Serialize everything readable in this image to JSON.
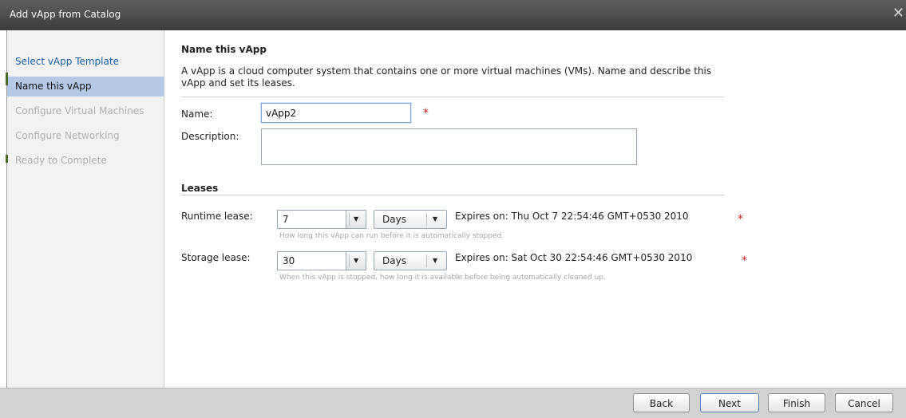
{
  "dialog": {
    "title": "Add vApp from Catalog"
  },
  "sidebar": {
    "items": [
      {
        "label": "Select vApp Template",
        "state": "link"
      },
      {
        "label": "Name this vApp",
        "state": "active"
      },
      {
        "label": "Configure Virtual Machines",
        "state": "disabled"
      },
      {
        "label": "Configure Networking",
        "state": "disabled"
      },
      {
        "label": "Ready to Complete",
        "state": "disabled"
      }
    ]
  },
  "main": {
    "title": "Name this vApp",
    "description": "A vApp is a cloud computer system that contains one or more virtual machines (VMs). Name and describe this vApp and set its leases.",
    "name_label": "Name:",
    "name_value": "vApp2",
    "description_label": "Description:",
    "description_value": "",
    "required_mark": "*"
  },
  "leases": {
    "title": "Leases",
    "runtime": {
      "label": "Runtime lease:",
      "value": "7",
      "unit": "Days",
      "expires": "Expires on: Thu Oct 7 22:54:46 GMT+0530 2010",
      "hint": "How long this vApp can run before it is automatically stopped."
    },
    "storage": {
      "label": "Storage lease:",
      "value": "30",
      "unit": "Days",
      "expires": "Expires on: Sat Oct 30 22:54:46 GMT+0530 2010",
      "hint": "When this vApp is stopped, how long it is available before being automatically cleaned up."
    }
  },
  "footer": {
    "back_label": "Back",
    "next_label": "Next",
    "finish_label": "Finish",
    "cancel_label": "Cancel"
  },
  "icons": {
    "close": "close-icon",
    "dropdown": "chevron-down-icon"
  },
  "colors": {
    "active_step_bg": "#b4c8e8",
    "link_color": "#1a5ea8",
    "required_color": "#d21a1a",
    "titlebar_bg": "#4a4a4a"
  }
}
